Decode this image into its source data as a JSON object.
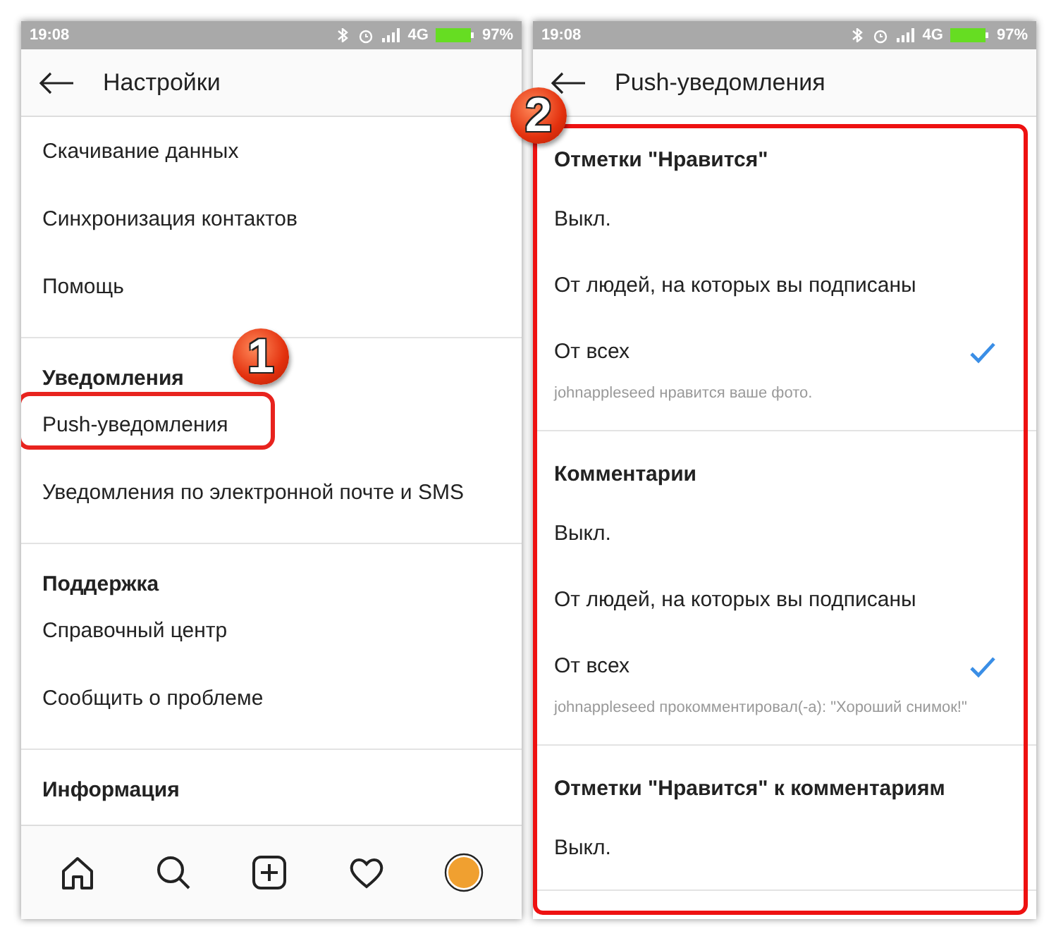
{
  "screens": [
    {
      "status_bar": {
        "time": "19:08",
        "network": "4G",
        "battery": "97%"
      },
      "title": "Настройки",
      "sections": [
        {
          "items": [
            {
              "kind": "link",
              "label": "Скачивание данных",
              "highlighted": false
            },
            {
              "kind": "link",
              "label": "Синхронизация контактов",
              "highlighted": false
            },
            {
              "kind": "link",
              "label": "Помощь",
              "highlighted": false
            }
          ]
        },
        {
          "title": "Уведомления",
          "items": [
            {
              "kind": "link",
              "label": "Push-уведомления",
              "highlighted": true,
              "badge": "1"
            },
            {
              "kind": "link",
              "label": "Уведомления по электронной почте и SMS",
              "highlighted": false
            }
          ]
        },
        {
          "title": "Поддержка",
          "items": [
            {
              "kind": "link",
              "label": "Справочный центр",
              "highlighted": false
            },
            {
              "kind": "link",
              "label": "Сообщить о проблеме",
              "highlighted": false
            }
          ]
        },
        {
          "title": "Информация"
        }
      ],
      "tab_bar": true
    },
    {
      "status_bar": {
        "time": "19:08",
        "network": "4G",
        "battery": "97%"
      },
      "title": "Push-уведомления",
      "highlighted": true,
      "badge": "2",
      "sections": [
        {
          "title": "Отметки \"Нравится\"",
          "items": [
            {
              "kind": "option",
              "label": "Выкл.",
              "selected": false
            },
            {
              "kind": "option",
              "label": "От людей, на которых вы подписаны",
              "selected": false
            },
            {
              "kind": "option",
              "label": "От всех",
              "selected": true
            },
            {
              "kind": "hint",
              "label": "johnappleseed нравится ваше фото."
            }
          ]
        },
        {
          "title": "Комментарии",
          "items": [
            {
              "kind": "option",
              "label": "Выкл.",
              "selected": false
            },
            {
              "kind": "option",
              "label": "От людей, на которых вы подписаны",
              "selected": false
            },
            {
              "kind": "option",
              "label": "От всех",
              "selected": true
            },
            {
              "kind": "hint",
              "label": "johnappleseed прокомментировал(-а): \"Хороший снимок!\""
            }
          ]
        },
        {
          "title": "Отметки \"Нравится\" к комментариям",
          "items": [
            {
              "kind": "option",
              "label": "Выкл.",
              "selected": false
            }
          ]
        }
      ]
    }
  ]
}
